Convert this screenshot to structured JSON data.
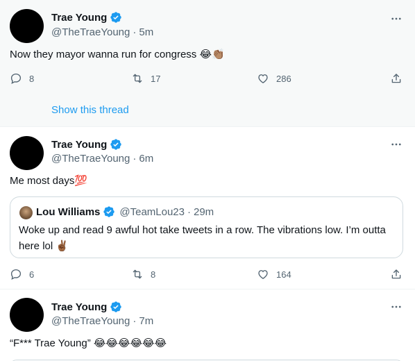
{
  "tweets": [
    {
      "name": "Trae Young",
      "handle": "@TheTraeYoung",
      "time": "5m",
      "text": "Now they mayor wanna run for congress 😂👏🏽",
      "replies": "8",
      "retweets": "17",
      "likes": "286",
      "thread_link": "Show this thread"
    },
    {
      "name": "Trae Young",
      "handle": "@TheTraeYoung",
      "time": "6m",
      "text": "Me most days💯",
      "quote": {
        "name": "Lou Williams",
        "handle": "@TeamLou23",
        "time": "29m",
        "text": "Woke up and read 9 awful hot take tweets in a row. The vibrations low. I’m outta here lol ✌🏾"
      },
      "replies": "6",
      "retweets": "8",
      "likes": "164"
    },
    {
      "name": "Trae Young",
      "handle": "@TheTraeYoung",
      "time": "7m",
      "text": "“F*** Trae Young” 😂😂😂😂😂😂"
    }
  ],
  "separator": "·",
  "colors": {
    "accent": "#1d9bf0",
    "secondary_text": "#536471",
    "highlight_bg": "#f7f9f9"
  },
  "icons": {
    "verified": "verified-badge-icon",
    "more": "more-dots-icon",
    "reply": "reply-bubble-icon",
    "retweet": "retweet-icon",
    "like": "heart-icon",
    "share": "share-icon"
  }
}
